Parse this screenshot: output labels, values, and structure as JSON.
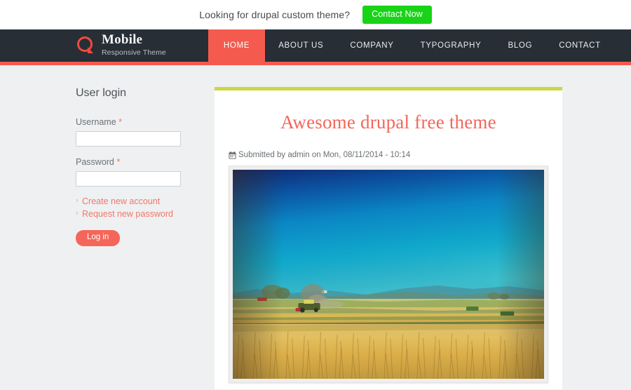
{
  "topbar": {
    "tagline": "Looking for drupal custom theme?",
    "cta_label": "Contact Now",
    "cta_color": "#18d417"
  },
  "header": {
    "background": "#272e36",
    "accent_color": "#f45b4e",
    "logo_icon": "q-circle-logo-icon",
    "brand_name": "Mobile",
    "brand_tagline": "Responsive Theme",
    "nav": [
      {
        "label": "HOME",
        "active": true
      },
      {
        "label": "ABOUT US",
        "active": false
      },
      {
        "label": "COMPANY",
        "active": false
      },
      {
        "label": "TYPOGRAPHY",
        "active": false
      },
      {
        "label": "BLOG",
        "active": false
      },
      {
        "label": "CONTACT",
        "active": false
      }
    ]
  },
  "sidebar": {
    "title": "User login",
    "username": {
      "label": "Username",
      "required_marker": "*",
      "value": "",
      "placeholder": ""
    },
    "password": {
      "label": "Password",
      "required_marker": "*",
      "value": "",
      "placeholder": ""
    },
    "links": [
      {
        "label": "Create new account",
        "bullet": "›"
      },
      {
        "label": "Request new password",
        "bullet": "›"
      }
    ],
    "submit_label": "Log in",
    "link_color": "#f2776b",
    "button_color": "#f4665a"
  },
  "content": {
    "accent_color": "#ccd840",
    "article": {
      "title": "Awesome drupal free theme",
      "title_color": "#f4665a",
      "meta_icon": "calendar-icon",
      "meta": "Submitted by admin on Mon, 08/11/2014 - 10:14",
      "image_alt": "Combine harvester working in a golden wheat field under a deep blue sky"
    }
  }
}
